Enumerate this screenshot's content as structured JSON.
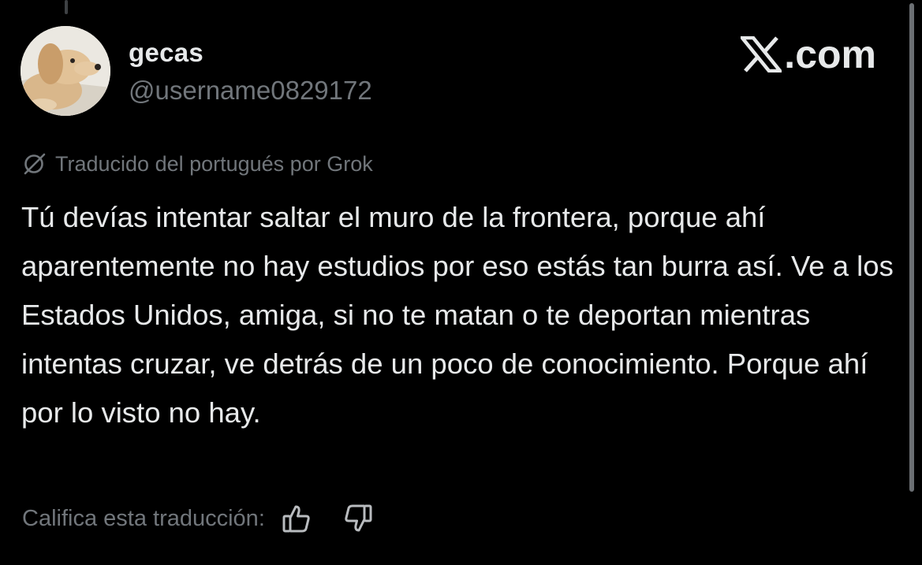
{
  "author": {
    "display_name": "gecas",
    "handle": "@username0829172"
  },
  "brand": {
    "label": ".com",
    "icon": "x-logo-icon"
  },
  "translation": {
    "notice": "Traducido del portugués por Grok",
    "icon": "grok-icon"
  },
  "tweet": {
    "text": "Tú devías intentar saltar el muro de la frontera, porque ahí aparentemente no hay estudios por eso estás tan burra así. Ve a los Estados Unidos, amiga, si no te matan o te deportan mientras intentas cruzar, ve detrás de un poco de conocimiento. Porque ahí por lo visto no hay."
  },
  "rating": {
    "prompt": "Califica esta traducción:",
    "icons": [
      "thumbs-up-icon",
      "thumbs-down-icon"
    ]
  },
  "colors": {
    "background": "#000000",
    "primary_text": "#e7e9ea",
    "secondary_text": "#71767b"
  }
}
